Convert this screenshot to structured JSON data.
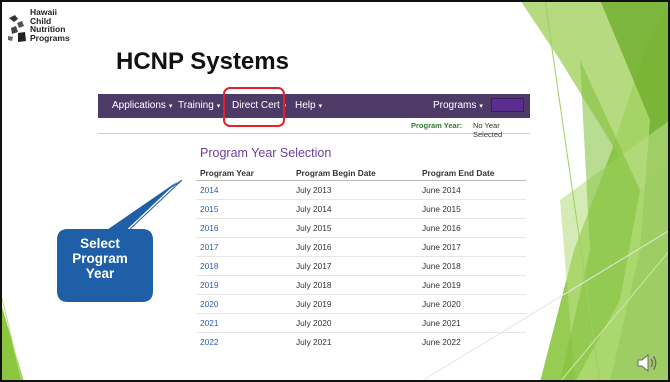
{
  "logo": {
    "lines": [
      "Hawaii",
      "Child",
      "Nutrition",
      "Programs"
    ]
  },
  "title": "HCNP Systems",
  "navbar": {
    "items": [
      {
        "label": "Applications",
        "caret": "▾"
      },
      {
        "label": "Training",
        "caret": "▾"
      },
      {
        "label": "Direct Cert",
        "caret": "▾"
      },
      {
        "label": "Help",
        "caret": "▾"
      },
      {
        "label": "Programs",
        "caret": "▾"
      }
    ]
  },
  "status": {
    "label": "Program Year:",
    "value": "No Year Selected"
  },
  "section_title": "Program Year Selection",
  "table": {
    "headers": [
      "Program Year",
      "Program Begin Date",
      "Program End Date"
    ],
    "rows": [
      {
        "year": "2014",
        "begin": "July 2013",
        "end": "June 2014"
      },
      {
        "year": "2015",
        "begin": "July 2014",
        "end": "June 2015"
      },
      {
        "year": "2016",
        "begin": "July 2015",
        "end": "June 2016"
      },
      {
        "year": "2017",
        "begin": "July 2016",
        "end": "June 2017"
      },
      {
        "year": "2018",
        "begin": "July 2017",
        "end": "June 2018"
      },
      {
        "year": "2019",
        "begin": "July 2018",
        "end": "June 2019"
      },
      {
        "year": "2020",
        "begin": "July 2019",
        "end": "June 2020"
      },
      {
        "year": "2021",
        "begin": "July 2020",
        "end": "June 2021"
      },
      {
        "year": "2022",
        "begin": "July 2021",
        "end": "June 2022"
      }
    ]
  },
  "callout": {
    "lines": [
      "Select",
      "Program",
      "Year"
    ]
  },
  "colors": {
    "accent_green": "#8cc63f",
    "nav_purple": "#4e3a67",
    "callout_blue": "#1f5fa8",
    "highlight_red": "#e4202b",
    "link_blue": "#2f5ea8",
    "section_purple": "#6b3fa0"
  },
  "icons": {
    "logo": "hawaii-islands-logo-icon",
    "speaker": "speaker-audio-icon",
    "caret": "caret-down-icon"
  }
}
